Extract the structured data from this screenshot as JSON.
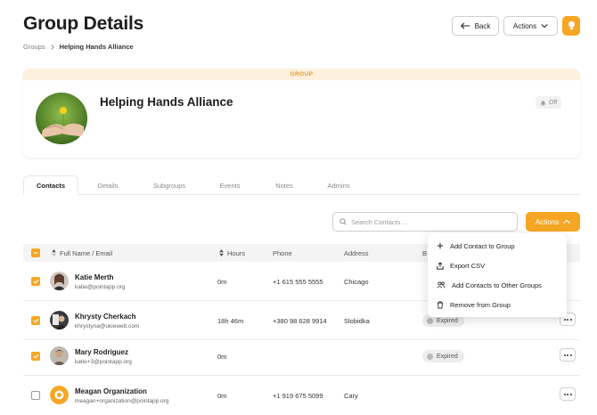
{
  "header": {
    "title": "Group Details",
    "back_label": "Back",
    "actions_label": "Actions"
  },
  "breadcrumb": {
    "root": "Groups",
    "current": "Helping Hands Alliance"
  },
  "group": {
    "band_label": "GROUP",
    "name": "Helping Hands Alliance",
    "notifications": "Off"
  },
  "tabs": [
    {
      "label": "Contacts",
      "active": true
    },
    {
      "label": "Details",
      "active": false
    },
    {
      "label": "Subgroups",
      "active": false
    },
    {
      "label": "Events",
      "active": false
    },
    {
      "label": "Notes",
      "active": false
    },
    {
      "label": "Admins",
      "active": false
    }
  ],
  "search": {
    "placeholder": "Search Contacts ..."
  },
  "table_actions_label": "Actions",
  "table": {
    "columns": {
      "name": "Full Name / Email",
      "hours": "Hours",
      "phone": "Phone",
      "address": "Address",
      "status": "B"
    },
    "rows": [
      {
        "name": "Katie Merth",
        "email": "katie@pointapp.org",
        "hours": "0m",
        "phone": "+1 615 555 5555",
        "address": "Chicago",
        "status": "",
        "checked": true
      },
      {
        "name": "Khrysty Cherkach",
        "email": "khrystyna@ukieweb.com",
        "hours": "18h 46m",
        "phone": "+380 98 628 9914",
        "address": "Slobidka",
        "status": "",
        "checked": true
      },
      {
        "name": "Mary Rodriguez",
        "email": "katie+3@pointapp.org",
        "hours": "0m",
        "phone": "",
        "address": "",
        "status": "Expired",
        "checked": true
      },
      {
        "name": "Meagan Organization",
        "email": "meagan+organization@pointapp.org",
        "hours": "0m",
        "phone": "+1 919 675 5099",
        "address": "Cary",
        "status": "",
        "checked": false
      }
    ],
    "row2_status_partial": "Expired"
  },
  "dropdown": {
    "items": [
      {
        "label": "Add Contact to Group",
        "icon": "plus-icon"
      },
      {
        "label": "Export CSV",
        "icon": "export-icon"
      },
      {
        "label": "Add Contacts to Other Groups",
        "icon": "users-icon"
      },
      {
        "label": "Remove from Group",
        "icon": "trash-icon"
      }
    ]
  },
  "colors": {
    "accent": "#f5a623",
    "band": "#fdf0dd"
  }
}
